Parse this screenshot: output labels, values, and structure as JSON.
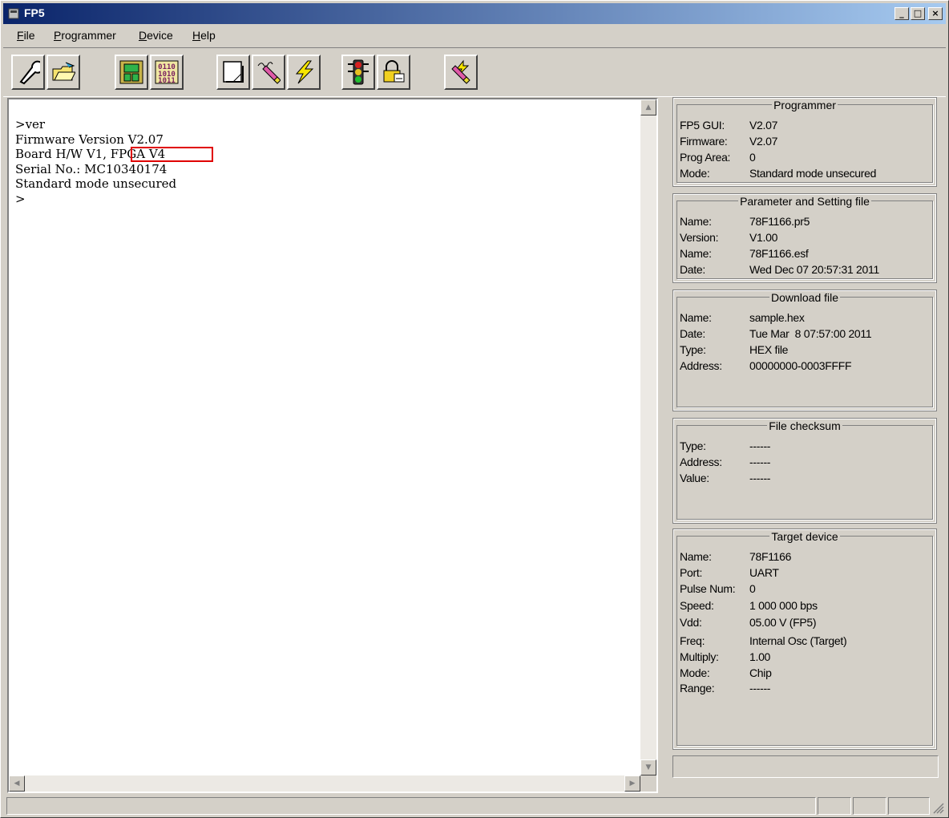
{
  "window": {
    "title": "FP5"
  },
  "menu": [
    {
      "label": "File",
      "accel": "F",
      "rest": "ile"
    },
    {
      "label": "Programmer",
      "accel": "P",
      "rest": "rogrammer"
    },
    {
      "label": "Device",
      "accel": "D",
      "rest": "evice"
    },
    {
      "label": "Help",
      "accel": "H",
      "rest": "elp"
    }
  ],
  "toolbar": [
    "setup-tool-icon",
    "open-folder-icon",
    "device-chip-icon",
    "binary-data-icon",
    "blank-page-icon",
    "erase-pen-icon",
    "program-lightning-icon",
    "traffic-light-icon",
    "security-lock-icon",
    "autoprocedure-pen-icon"
  ],
  "console": {
    "lines": [
      ">ver",
      "Firmware Version V2.07",
      "Board H/W V1, FPGA V4",
      "Serial No.: MC10340174",
      "Standard mode unsecured",
      ">"
    ]
  },
  "programmer": {
    "title": "Programmer",
    "rows": [
      {
        "k": "FP5 GUI:",
        "v": "V2.07"
      },
      {
        "k": "Firmware:",
        "v": "V2.07"
      },
      {
        "k": "Prog Area:",
        "v": "0"
      },
      {
        "k": "Mode:",
        "v": "Standard mode unsecured"
      }
    ]
  },
  "parameter": {
    "title": "Parameter and Setting file",
    "rows": [
      {
        "k": "Name:",
        "v": "78F1166.pr5"
      },
      {
        "k": "Version:",
        "v": "V1.00"
      },
      {
        "k": "Name:",
        "v": "78F1166.esf"
      },
      {
        "k": "Date:",
        "v": "Wed Dec 07 20:57:31 2011"
      }
    ]
  },
  "download": {
    "title": "Download file",
    "rows": [
      {
        "k": "Name:",
        "v": "sample.hex"
      },
      {
        "k": "Date:",
        "v": "Tue Mar  8 07:57:00 2011"
      },
      {
        "k": "Type:",
        "v": "HEX file"
      },
      {
        "k": "Address:",
        "v": "00000000-0003FFFF"
      }
    ]
  },
  "checksum": {
    "title": "File checksum",
    "rows": [
      {
        "k": "Type:",
        "v": "------"
      },
      {
        "k": "Address:",
        "v": "------"
      },
      {
        "k": "Value:",
        "v": "------"
      }
    ]
  },
  "target": {
    "title": "Target device",
    "rows": [
      {
        "k": "Name:",
        "v": "78F1166"
      },
      {
        "k": "Port:",
        "v": "UART"
      },
      {
        "k": "Pulse Num:",
        "v": "0"
      },
      {
        "k": "Speed:",
        "v": "1 000 000 bps"
      },
      {
        "k": "Vdd:",
        "v": "05.00 V (FP5)"
      },
      {
        "k": "Freq:",
        "v": "Internal Osc (Target)"
      },
      {
        "k": "Multiply:",
        "v": "1.00"
      },
      {
        "k": "Mode:",
        "v": "Chip"
      },
      {
        "k": "Range:",
        "v": "------"
      }
    ]
  }
}
